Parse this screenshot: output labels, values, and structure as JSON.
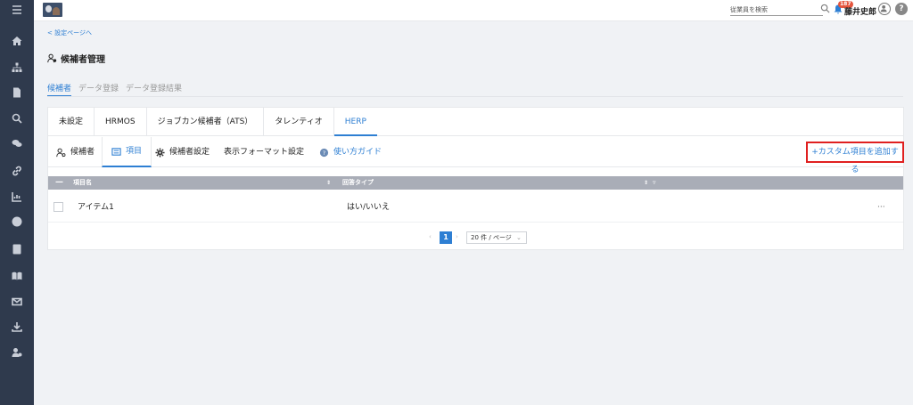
{
  "header": {
    "search_placeholder": "従業員を検索",
    "notification_count": "187",
    "user_name": "藤井史郎",
    "help_label": "?"
  },
  "sidebar": {
    "items": [
      "home-icon",
      "org-chart-icon",
      "document-icon",
      "search-icon",
      "chat-icon",
      "link-icon",
      "chart-icon",
      "globe-icon",
      "contact-book-icon",
      "book-icon",
      "mail-icon",
      "download-icon",
      "candidate-icon"
    ]
  },
  "page": {
    "back_link": "< 設定ページへ",
    "title": "候補者管理",
    "tabs": [
      {
        "label": "候補者",
        "active": true
      },
      {
        "label": "データ登録",
        "active": false
      },
      {
        "label": "データ登録結果",
        "active": false
      }
    ]
  },
  "ats_tabs": [
    {
      "label": "未設定",
      "active": false
    },
    {
      "label": "HRMOS",
      "active": false
    },
    {
      "label": "ジョブカン候補者（ATS）",
      "active": false
    },
    {
      "label": "タレンティオ",
      "active": false
    },
    {
      "label": "HERP",
      "active": true
    }
  ],
  "sub_tabs": {
    "candidates": "候補者",
    "items": "項目",
    "settings": "候補者設定",
    "format": "表示フォーマット設定",
    "guide": "使い方ガイド"
  },
  "add_button": "+カスタム項目を追加する",
  "table": {
    "columns": {
      "name": "項目名",
      "type": "回答タイプ"
    },
    "rows": [
      {
        "name": "アイテム1",
        "type": "はい/いいえ",
        "menu": "···"
      }
    ]
  },
  "pagination": {
    "current_page": "1",
    "page_size": "20 件 / ページ"
  },
  "colors": {
    "accent": "#2e7fd3",
    "sidebar": "#2f3a4d",
    "highlight_border": "#e02020",
    "table_header": "#a9adb7"
  }
}
